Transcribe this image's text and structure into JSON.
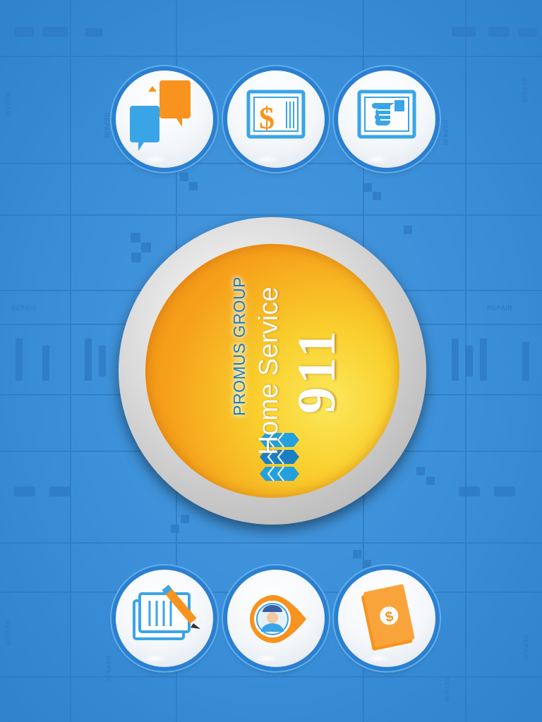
{
  "app": {
    "brand": "PROMUS GROUP",
    "title": "Home Service",
    "number": "911"
  },
  "background": {
    "repeat_text": "REPAIR"
  },
  "colors": {
    "background": "#3a8fd8",
    "button_ring": "#2b7fd0",
    "accent_orange": "#f7931e",
    "accent_blue": "#35a0e0",
    "brand_blue": "#1b7fc4"
  },
  "buttons": {
    "top": [
      {
        "name": "chat-button",
        "icon": "chat-bubbles-icon"
      },
      {
        "name": "pricing-button",
        "icon": "dollar-document-icon"
      },
      {
        "name": "hire-button",
        "icon": "hand-pointing-icon"
      }
    ],
    "bottom": [
      {
        "name": "order-form-button",
        "icon": "document-pencil-icon"
      },
      {
        "name": "technician-location-button",
        "icon": "location-pin-technician-icon"
      },
      {
        "name": "payment-button",
        "icon": "money-bill-icon"
      }
    ]
  }
}
